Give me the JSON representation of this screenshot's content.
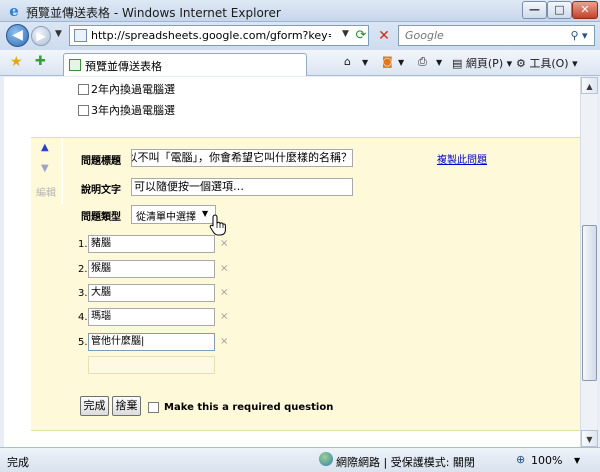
{
  "window": {
    "title": "預覽並傳送表格 - Windows Internet Explorer",
    "min_glyph": "—",
    "max_glyph": "□",
    "close_glyph": "✕"
  },
  "address": {
    "url": "http://spreadsheets.google.com/gform?key=pytbFzE",
    "search_placeholder": "Google"
  },
  "command_bar": {
    "tab_label": "預覽並傳送表格",
    "page_label": "網頁(P)",
    "tools_label": "工具(O)"
  },
  "form": {
    "previous_options": [
      "2年內換過電腦選",
      "3年內換過電腦選"
    ],
    "side": {
      "edit_label": "編輯"
    },
    "question_title_label": "問題標題",
    "question_title_value": "以不叫「電腦」，你會希望它叫什麼樣的名稱？",
    "copy_question_link": "複製此問題",
    "help_text_label": "說明文字",
    "help_text_value": "可以隨便按一個選項…",
    "question_type_label": "問題類型",
    "question_type_value": "從清單中選擇",
    "choices": [
      {
        "num": "1.",
        "value": "豬腦"
      },
      {
        "num": "2.",
        "value": "猴腦"
      },
      {
        "num": "3.",
        "value": "大腦"
      },
      {
        "num": "4.",
        "value": "瑪瑙"
      },
      {
        "num": "5.",
        "value": "管他什麼腦"
      }
    ],
    "delete_glyph": "×",
    "done_button": "完成",
    "discard_button": "捨棄",
    "required_label": "Make this a required question"
  },
  "status": {
    "text": "完成",
    "zone": "網際網路 | 受保護模式: 關閉",
    "zoom": "100%"
  },
  "colors": {
    "panel": "#fef9d9",
    "link": "#0000cc",
    "close": "#c6412a"
  }
}
